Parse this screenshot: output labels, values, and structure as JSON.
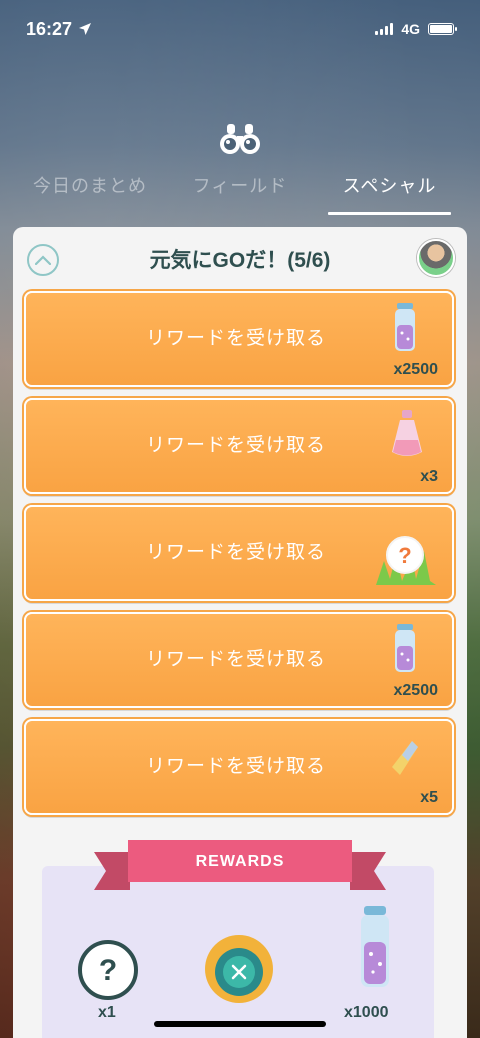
{
  "status": {
    "time": "16:27",
    "network": "4G",
    "location_icon": "location-arrow-icon"
  },
  "tabs": [
    {
      "label": "今日のまとめ",
      "active": false
    },
    {
      "label": "フィールド",
      "active": false
    },
    {
      "label": "スペシャル",
      "active": true
    }
  ],
  "research": {
    "title": "元気にGOだ！(5/6)",
    "rewards": [
      {
        "label": "リワードを受け取る",
        "item": "stardust-icon",
        "qty": "x2500"
      },
      {
        "label": "リワードを受け取る",
        "item": "incense-icon",
        "qty": "x3"
      },
      {
        "label": "リワードを受け取る",
        "item": "encounter-icon",
        "qty": ""
      },
      {
        "label": "リワードを受け取る",
        "item": "stardust-icon",
        "qty": "x2500"
      },
      {
        "label": "リワードを受け取る",
        "item": "rare-candy-icon",
        "qty": "x5"
      }
    ]
  },
  "final_rewards": {
    "title": "REWARDS",
    "items": [
      {
        "item": "mystery-encounter-icon",
        "qty": "x1"
      },
      {
        "item": "pokeball-capture-icon",
        "qty": ""
      },
      {
        "item": "stardust-icon",
        "qty": "x1000"
      }
    ]
  },
  "colors": {
    "orange": "#f9a343",
    "teal": "#2f4f4f",
    "ribbon": "#ec5b7f",
    "panel": "#f4f4f4"
  }
}
